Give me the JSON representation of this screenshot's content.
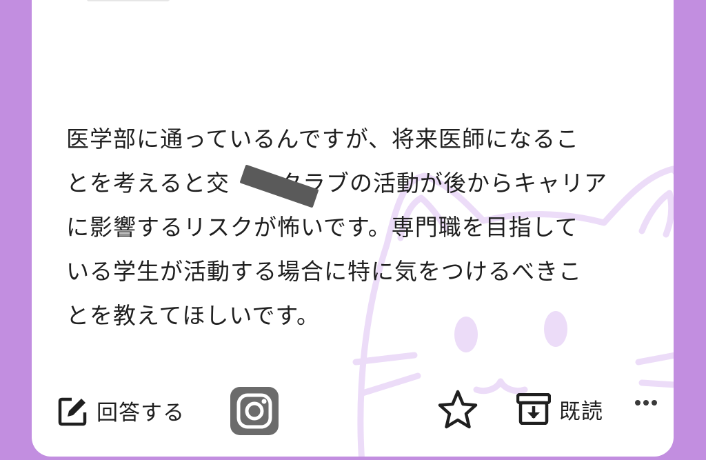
{
  "question": {
    "lines": [
      "医学部に通っているんですが、将来医師になるこ",
      "とを考えると交",
      "クラブの活動が後からキャリア",
      "に影響するリスクが怖いです。専門職を目指して",
      "いる学生が活動する場合に特に気をつけるべきこ",
      "とを教えてほしいです。"
    ]
  },
  "actions": {
    "answer_label": "回答する",
    "read_label": "既読"
  },
  "icons": {
    "answer": "edit-icon",
    "instagram": "instagram-icon",
    "favorite": "star-icon",
    "read": "archive-icon",
    "more": "more-icon"
  },
  "colors": {
    "frame": "#c28ee0",
    "watermark": "#ecdcf8",
    "text": "#1f1f1f",
    "instagram_tile": "#6b6b6b",
    "redaction": "#5a5a5a"
  }
}
